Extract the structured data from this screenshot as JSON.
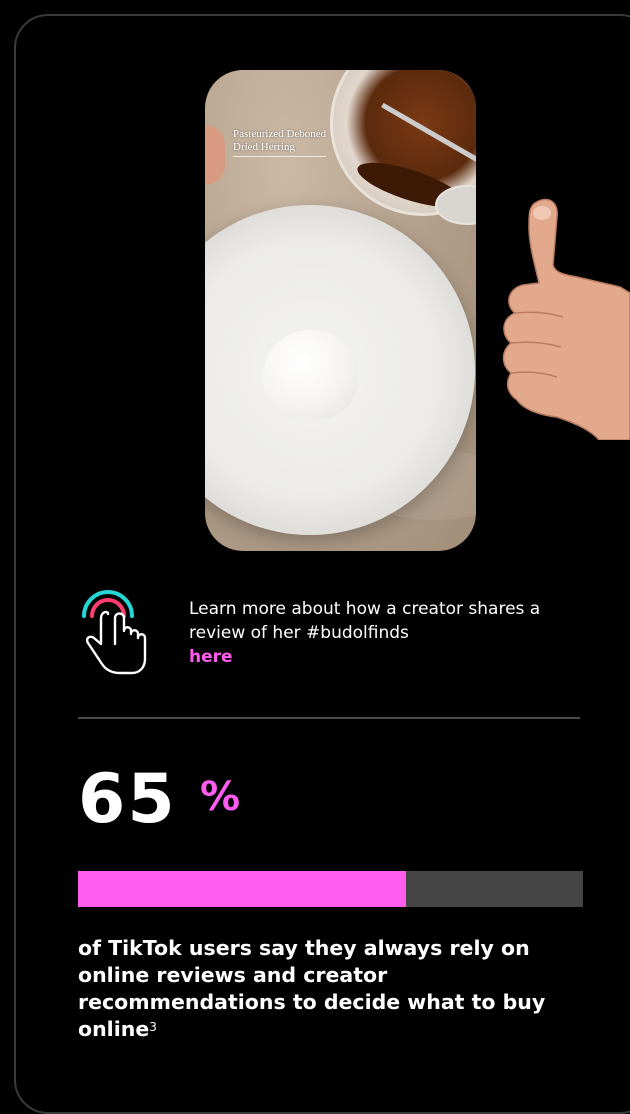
{
  "video": {
    "caption_line1": "Pasteurized Deboned",
    "caption_line2": "Dried Herring",
    "subtitle": "",
    "icon": "thumbs-up-icon"
  },
  "cta": {
    "text": "Learn more about how a creator shares a review of her #budolfinds",
    "link_label": "here",
    "icon": "tap-hand-icon"
  },
  "stat": {
    "number": "65",
    "unit": "%",
    "progress_percent": 65,
    "description": "of TikTok users say they always rely on online reviews and creator recommendations to decide what to buy online",
    "footnote": "3"
  },
  "colors": {
    "accent": "#ff5cf0",
    "track": "#444444",
    "background": "#000000",
    "icon_teal": "#25d6d6",
    "icon_pink": "#ff3d6e"
  }
}
